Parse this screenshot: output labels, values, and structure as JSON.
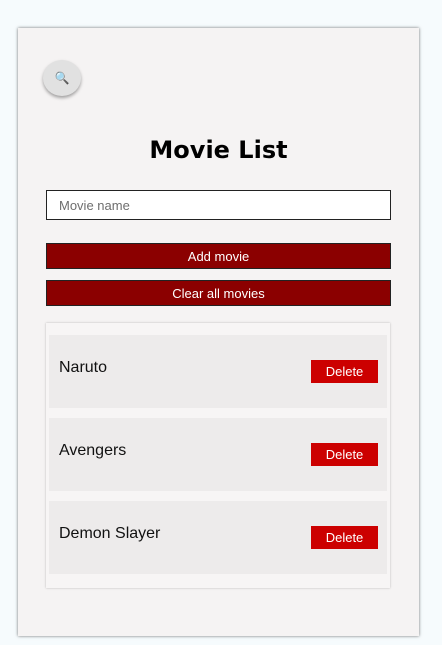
{
  "search": {
    "icon": "magnifier-icon",
    "glyph": "🔍"
  },
  "header": {
    "title": "Movie List"
  },
  "form": {
    "placeholder": "Movie name",
    "value": "",
    "add_label": "Add movie",
    "clear_label": "Clear all movies"
  },
  "movies": [
    {
      "name": "Naruto",
      "delete_label": "Delete"
    },
    {
      "name": "Avengers",
      "delete_label": "Delete"
    },
    {
      "name": "Demon Slayer",
      "delete_label": "Delete"
    }
  ],
  "colors": {
    "primary_button": "#8b0000",
    "delete_button": "#cc0000",
    "card_background": "#f5f3f3"
  }
}
